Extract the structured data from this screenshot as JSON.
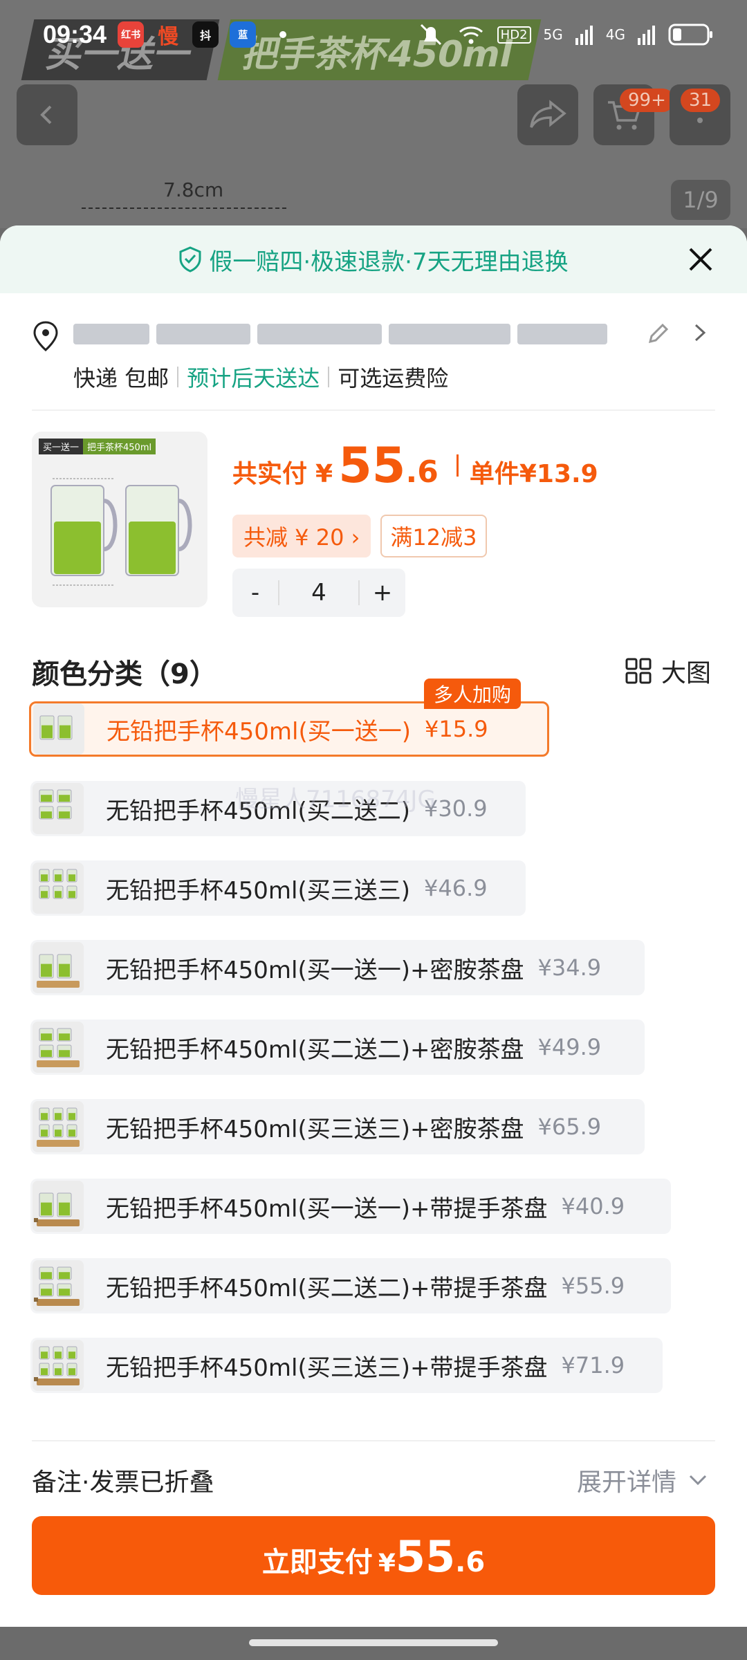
{
  "status_bar": {
    "time": "09:34",
    "app_icons": [
      "红书",
      "慢",
      "抖",
      "蓝"
    ],
    "network": "5G",
    "network2": "4G",
    "hd": "HD2"
  },
  "background": {
    "banner_left": "买一送一",
    "banner_right": "把手茶杯450ml",
    "cart_badge": "99+",
    "msg_badge": "31",
    "dimension": "7.8cm",
    "page_indicator": "1/9"
  },
  "guarantee": {
    "text": "假一赔四·极速退款·7天无理由退换"
  },
  "address": {
    "ship_method": "快递 包邮",
    "delivery": "预计后天送达",
    "optional": "可选运费险"
  },
  "product": {
    "thumb_tag1": "买一送一",
    "thumb_tag2": "把手茶杯450ml",
    "total_label": "共实付",
    "currency": "¥",
    "total_int": "55",
    "total_dec": ".6",
    "unit_price": "单件¥13.9",
    "discount": "共减 ¥ 20 ›",
    "promo": "满12减3",
    "qty_minus": "-",
    "quantity": "4",
    "qty_plus": "+"
  },
  "section": {
    "title": "颜色分类（9）",
    "big_view": "大图"
  },
  "options": [
    {
      "name": "无铅把手杯450ml(买一送一)",
      "price": "¥15.9",
      "selected": true,
      "tag": "多人加购",
      "cups": 2,
      "tray": "none"
    },
    {
      "name": "无铅把手杯450ml(买二送二)",
      "price": "¥30.9",
      "selected": false,
      "cups": 4,
      "tray": "none"
    },
    {
      "name": "无铅把手杯450ml(买三送三)",
      "price": "¥46.9",
      "selected": false,
      "cups": 6,
      "tray": "none"
    },
    {
      "name": "无铅把手杯450ml(买一送一)+密胺茶盘",
      "price": "¥34.9",
      "selected": false,
      "cups": 2,
      "tray": "melamine"
    },
    {
      "name": "无铅把手杯450ml(买二送二)+密胺茶盘",
      "price": "¥49.9",
      "selected": false,
      "cups": 4,
      "tray": "melamine"
    },
    {
      "name": "无铅把手杯450ml(买三送三)+密胺茶盘",
      "price": "¥65.9",
      "selected": false,
      "cups": 6,
      "tray": "melamine"
    },
    {
      "name": "无铅把手杯450ml(买一送一)+带提手茶盘",
      "price": "¥40.9",
      "selected": false,
      "cups": 2,
      "tray": "handle"
    },
    {
      "name": "无铅把手杯450ml(买二送二)+带提手茶盘",
      "price": "¥55.9",
      "selected": false,
      "cups": 4,
      "tray": "handle"
    },
    {
      "name": "无铅把手杯450ml(买三送三)+带提手茶盘",
      "price": "¥71.9",
      "selected": false,
      "cups": 6,
      "tray": "handle"
    }
  ],
  "watermark": "慢星人7116874JG",
  "notes": {
    "label": "备注·发票已折叠",
    "expand": "展开详情"
  },
  "pay_button": {
    "label": "立即支付",
    "currency": "¥",
    "amount_int": "55",
    "amount_dec": ".6"
  },
  "colors": {
    "accent": "#f75a0a",
    "green": "#16a383"
  }
}
